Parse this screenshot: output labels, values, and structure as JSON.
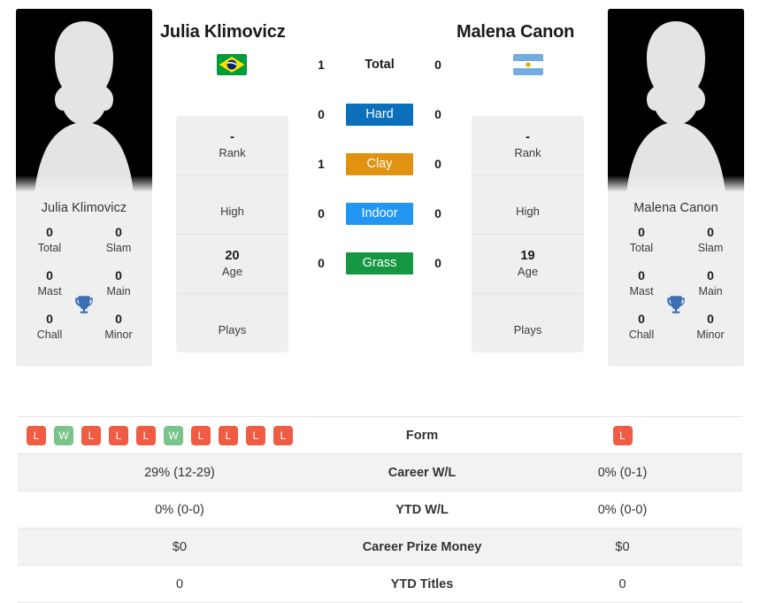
{
  "players": [
    {
      "name": "Julia Klimovicz",
      "card_name": "Julia Klimovicz",
      "country": "Brazil",
      "flag_icon": "brazil-flag-icon",
      "titles": {
        "total_value": "0",
        "total_label": "Total",
        "slam_value": "0",
        "slam_label": "Slam",
        "mast_value": "0",
        "mast_label": "Mast",
        "main_value": "0",
        "main_label": "Main",
        "chall_value": "0",
        "chall_label": "Chall",
        "minor_value": "0",
        "minor_label": "Minor"
      },
      "info": {
        "rank_value": "-",
        "rank_label": "Rank",
        "high_value": "",
        "high_label": "High",
        "age_value": "20",
        "age_label": "Age",
        "plays_value": "",
        "plays_label": "Plays"
      }
    },
    {
      "name": "Malena Canon",
      "card_name": "Malena Canon",
      "country": "Argentina",
      "flag_icon": "argentina-flag-icon",
      "titles": {
        "total_value": "0",
        "total_label": "Total",
        "slam_value": "0",
        "slam_label": "Slam",
        "mast_value": "0",
        "mast_label": "Mast",
        "main_value": "0",
        "main_label": "Main",
        "chall_value": "0",
        "chall_label": "Chall",
        "minor_value": "0",
        "minor_label": "Minor"
      },
      "info": {
        "rank_value": "-",
        "rank_label": "Rank",
        "high_value": "",
        "high_label": "High",
        "age_value": "19",
        "age_label": "Age",
        "plays_value": "",
        "plays_label": "Plays"
      }
    }
  ],
  "head_to_head": [
    {
      "label": "Total",
      "left": "1",
      "right": "0",
      "color": "",
      "plain": true
    },
    {
      "label": "Hard",
      "left": "0",
      "right": "0",
      "color": "#0b6fba",
      "plain": false
    },
    {
      "label": "Clay",
      "left": "1",
      "right": "0",
      "color": "#e09210",
      "plain": false
    },
    {
      "label": "Indoor",
      "left": "0",
      "right": "0",
      "color": "#2196f3",
      "plain": false
    },
    {
      "label": "Grass",
      "left": "0",
      "right": "0",
      "color": "#159641",
      "plain": false
    }
  ],
  "form": {
    "label": "Form",
    "win_color": "#7ac389",
    "loss_color": "#f05b43",
    "left_results": [
      "L",
      "W",
      "L",
      "L",
      "L",
      "W",
      "L",
      "L",
      "L",
      "L"
    ],
    "right_results": [
      "L"
    ]
  },
  "stats_rows": [
    {
      "label": "Career W/L",
      "left": "29% (12-29)",
      "right": "0% (0-1)"
    },
    {
      "label": "YTD W/L",
      "left": "0% (0-0)",
      "right": "0% (0-0)"
    },
    {
      "label": "Career Prize Money",
      "left": "$0",
      "right": "$0"
    },
    {
      "label": "YTD Titles",
      "left": "0",
      "right": "0"
    }
  ],
  "icons": {
    "trophy": "trophy-icon",
    "avatar": "player-avatar-icon"
  },
  "colors": {
    "trophy": "#3b6fb1",
    "card_bg": "#efefef",
    "row_shade": "#f2f2f2"
  }
}
